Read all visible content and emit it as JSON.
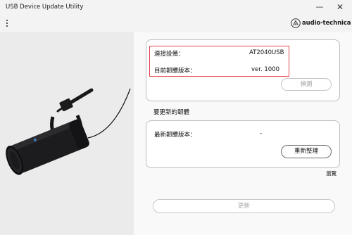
{
  "window": {
    "title": "USB Device Update Utility",
    "minimize_glyph": "—",
    "close_glyph": "✕"
  },
  "header": {
    "menu_icon": "more-vertical-icon",
    "brand_name": "audio-technica",
    "brand_logo": "audio-technica-logo"
  },
  "device": {
    "connected_label": "連接設備：",
    "connected_value": "AT2040USB",
    "firmware_label": "目前韌體版本：",
    "firmware_value": "ver. 1000",
    "detect_button": "偵測"
  },
  "update": {
    "section_title": "要更新的韌體",
    "latest_label": "最新韌體版本：",
    "latest_value": "-",
    "reorganize_button": "重新整理",
    "browse_link": "瀏覽",
    "update_button": "更新"
  },
  "colors": {
    "highlight_border": "#e4474f",
    "mic_body": "#1c1c1e",
    "mic_accent": "#3a7fc4"
  }
}
